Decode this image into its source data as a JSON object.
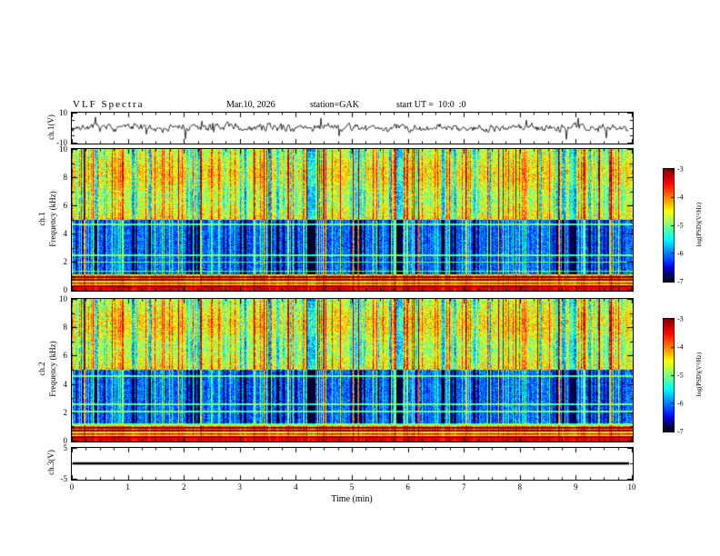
{
  "header": {
    "title": "VLF Spectra",
    "date": "Mar.10, 2026",
    "station": "station=GAK",
    "start_ut": "start UT =  10:0  :0"
  },
  "axes": {
    "x_label": "Time (min)",
    "x_ticks": [
      "0",
      "1",
      "2",
      "3",
      "4",
      "5",
      "6",
      "7",
      "8",
      "9",
      "10"
    ]
  },
  "colorbar": {
    "label": "log(PSD)(V²/Hz)",
    "ticks": [
      "-3",
      "-4",
      "-5",
      "-6",
      "-7"
    ]
  },
  "chart_data": [
    {
      "type": "line",
      "name": "ch1_waveform",
      "ylabel": "ch.1(V)",
      "xlim": [
        0,
        10
      ],
      "ylim": [
        -10,
        10
      ],
      "yticks_major": [
        10,
        -10
      ],
      "yticks_minor": [
        10,
        5,
        0,
        -5,
        -10
      ],
      "waveform": "noise",
      "amplitude_rms_V": 1.5,
      "spike_amplitude_V": 9,
      "line_color": "#000000",
      "description": "broadband VLF time series, continuous noise with impulsive spikes"
    },
    {
      "type": "heatmap",
      "name": "ch1_spectrogram",
      "channel": "ch.1",
      "ylabel": "Frequency (kHz)",
      "xlim": [
        0,
        10
      ],
      "ylim": [
        0,
        10
      ],
      "yticks_major": [
        10,
        8,
        6,
        4,
        2,
        0
      ],
      "yticks_minor": [
        0,
        1,
        2,
        3,
        4,
        5,
        6,
        7,
        8,
        9,
        10
      ],
      "zlim_logPSD": [
        -7,
        -3
      ],
      "colormap": "jet",
      "bands": [
        {
          "f_kHz": [
            0,
            1.1
          ],
          "logPSD": -3.6,
          "note": "red/orange/yellow horizontal stripes"
        },
        {
          "f_kHz": [
            1.1,
            5.0
          ],
          "logPSD": -6.1,
          "note": "dark blue background with cyan sferic streaks"
        },
        {
          "f_kHz": [
            5.0,
            10.0
          ],
          "logPSD": -4.6,
          "note": "green/yellow speckle with red sferic streaks"
        }
      ],
      "horizontal_lines_kHz": [
        1.35,
        2.0,
        2.5,
        4.7
      ],
      "vertical_streaks": "dense impulsive sferic streaks spanning 0-10 kHz reaching -3"
    },
    {
      "type": "heatmap",
      "name": "ch2_spectrogram",
      "channel": "ch.2",
      "ylabel": "Frequency (kHz)",
      "xlim": [
        0,
        10
      ],
      "ylim": [
        0,
        10
      ],
      "yticks_major": [
        10,
        8,
        6,
        4,
        2,
        0
      ],
      "yticks_minor": [
        0,
        1,
        2,
        3,
        4,
        5,
        6,
        7,
        8,
        9,
        10
      ],
      "zlim_logPSD": [
        -7,
        -3
      ],
      "colormap": "jet",
      "bands": [
        {
          "f_kHz": [
            0,
            1.1
          ],
          "logPSD": -3.6,
          "note": "red/orange/yellow horizontal stripes"
        },
        {
          "f_kHz": [
            1.1,
            5.0
          ],
          "logPSD": -6.1,
          "note": "dark blue background with cyan sferic streaks"
        },
        {
          "f_kHz": [
            5.0,
            10.0
          ],
          "logPSD": -4.6,
          "note": "green/yellow speckle with red sferic streaks"
        }
      ],
      "horizontal_lines_kHz": [
        1.2,
        2.1,
        2.6,
        4.6
      ],
      "vertical_streaks": "dense impulsive sferic streaks spanning 0-10 kHz reaching -3"
    },
    {
      "type": "line",
      "name": "ch3_waveform",
      "ylabel": "ch.3(V)",
      "xlim": [
        0,
        10
      ],
      "ylim": [
        -5,
        5
      ],
      "yticks_major": [
        5,
        -5
      ],
      "yticks_minor": [
        5,
        0,
        -5
      ],
      "waveform": "flat",
      "flat_value_V": 0,
      "line_color": "#000000",
      "description": "flat trace at 0 V"
    }
  ]
}
